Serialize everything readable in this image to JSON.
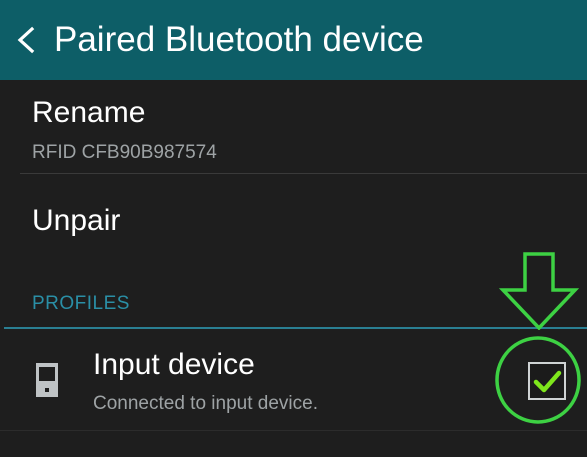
{
  "header": {
    "back_icon": "chevron-left-icon",
    "title": "Paired Bluetooth device"
  },
  "rename": {
    "title": "Rename",
    "subtitle": "RFID CFB90B987574"
  },
  "unpair": {
    "title": "Unpair"
  },
  "profiles": {
    "section_label": "PROFILES",
    "items": [
      {
        "icon": "phone-device-icon",
        "title": "Input device",
        "subtitle": "Connected to input device.",
        "checked": true
      }
    ]
  },
  "annotation": {
    "arrow_icon": "down-arrow-icon",
    "highlight": "circle-highlight",
    "color": "#3dd143"
  },
  "colors": {
    "header_bg": "#0d5e67",
    "accent": "#2a8fa6",
    "check": "#7ee61c",
    "background": "#1e1e1e"
  }
}
